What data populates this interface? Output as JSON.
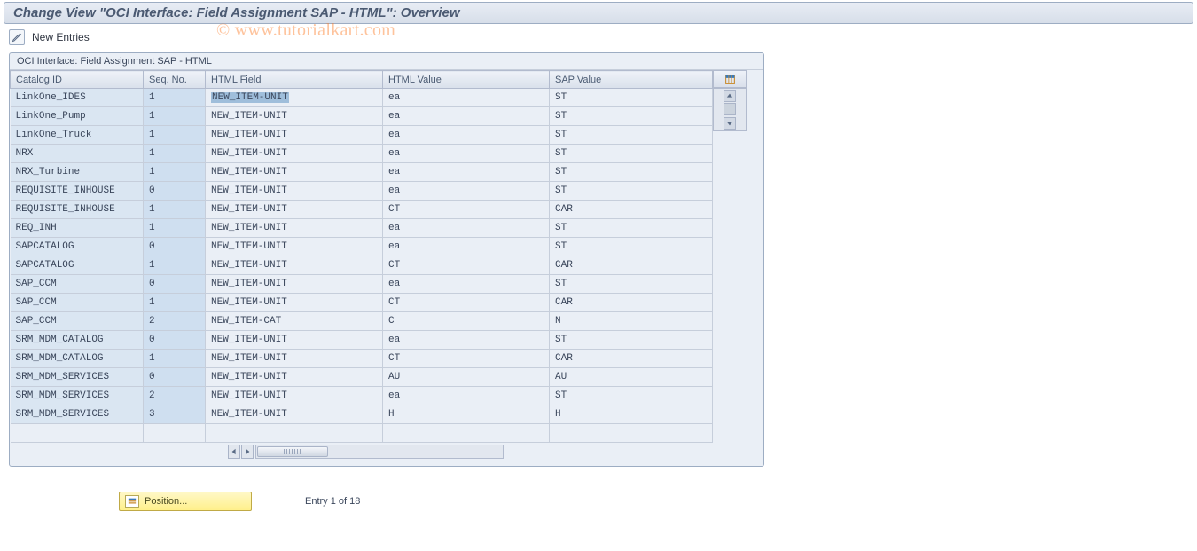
{
  "title": "Change View \"OCI Interface: Field Assignment SAP - HTML\": Overview",
  "toolbar": {
    "new_entries_label": "New Entries"
  },
  "watermark": "© www.tutorialkart.com",
  "panel": {
    "title": "OCI Interface: Field Assignment SAP - HTML"
  },
  "columns": {
    "catalog_id": "Catalog ID",
    "seq_no": "Seq. No.",
    "html_field": "HTML Field",
    "html_value": "HTML Value",
    "sap_value": "SAP Value"
  },
  "rows": [
    {
      "catalog": "LinkOne_IDES",
      "seq": "1",
      "field": "NEW_ITEM-UNIT",
      "hval": "ea",
      "sval": "ST",
      "hl": true
    },
    {
      "catalog": "LinkOne_Pump",
      "seq": "1",
      "field": "NEW_ITEM-UNIT",
      "hval": "ea",
      "sval": "ST"
    },
    {
      "catalog": "LinkOne_Truck",
      "seq": "1",
      "field": "NEW_ITEM-UNIT",
      "hval": "ea",
      "sval": "ST"
    },
    {
      "catalog": "NRX",
      "seq": "1",
      "field": "NEW_ITEM-UNIT",
      "hval": "ea",
      "sval": "ST"
    },
    {
      "catalog": "NRX_Turbine",
      "seq": "1",
      "field": "NEW_ITEM-UNIT",
      "hval": "ea",
      "sval": "ST"
    },
    {
      "catalog": "REQUISITE_INHOUSE",
      "seq": "0",
      "field": "NEW_ITEM-UNIT",
      "hval": "ea",
      "sval": "ST"
    },
    {
      "catalog": "REQUISITE_INHOUSE",
      "seq": "1",
      "field": "NEW_ITEM-UNIT",
      "hval": "CT",
      "sval": "CAR"
    },
    {
      "catalog": "REQ_INH",
      "seq": "1",
      "field": "NEW_ITEM-UNIT",
      "hval": "ea",
      "sval": "ST"
    },
    {
      "catalog": "SAPCATALOG",
      "seq": "0",
      "field": "NEW_ITEM-UNIT",
      "hval": "ea",
      "sval": "ST"
    },
    {
      "catalog": "SAPCATALOG",
      "seq": "1",
      "field": "NEW_ITEM-UNIT",
      "hval": "CT",
      "sval": "CAR"
    },
    {
      "catalog": "SAP_CCM",
      "seq": "0",
      "field": "NEW_ITEM-UNIT",
      "hval": "ea",
      "sval": "ST"
    },
    {
      "catalog": "SAP_CCM",
      "seq": "1",
      "field": "NEW_ITEM-UNIT",
      "hval": "CT",
      "sval": "CAR"
    },
    {
      "catalog": "SAP_CCM",
      "seq": "2",
      "field": "NEW_ITEM-CAT",
      "hval": "C",
      "sval": "N"
    },
    {
      "catalog": "SRM_MDM_CATALOG",
      "seq": "0",
      "field": "NEW_ITEM-UNIT",
      "hval": "ea",
      "sval": "ST"
    },
    {
      "catalog": "SRM_MDM_CATALOG",
      "seq": "1",
      "field": "NEW_ITEM-UNIT",
      "hval": "CT",
      "sval": "CAR"
    },
    {
      "catalog": "SRM_MDM_SERVICES",
      "seq": "0",
      "field": "NEW_ITEM-UNIT",
      "hval": "AU",
      "sval": "AU"
    },
    {
      "catalog": "SRM_MDM_SERVICES",
      "seq": "2",
      "field": "NEW_ITEM-UNIT",
      "hval": "ea",
      "sval": "ST"
    },
    {
      "catalog": "SRM_MDM_SERVICES",
      "seq": "3",
      "field": "NEW_ITEM-UNIT",
      "hval": "H",
      "sval": "H"
    }
  ],
  "footer": {
    "position_label": "Position...",
    "entry_text": "Entry 1 of 18"
  }
}
